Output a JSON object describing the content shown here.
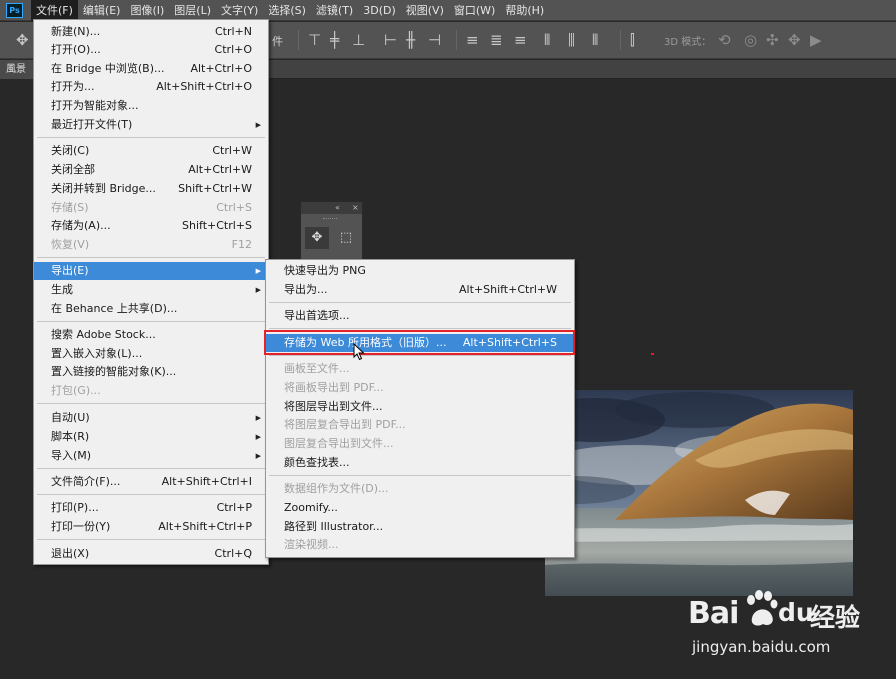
{
  "app": {
    "logo_text": "Ps"
  },
  "menubar": {
    "items": [
      "文件(F)",
      "编辑(E)",
      "图像(I)",
      "图层(L)",
      "文字(Y)",
      "选择(S)",
      "滤镜(T)",
      "3D(D)",
      "视图(V)",
      "窗口(W)",
      "帮助(H)"
    ]
  },
  "optionsbar": {
    "file_label_fragment": "件",
    "mode_3d_label": "3D 模式："
  },
  "document": {
    "tab_label": "風景"
  },
  "file_menu": {
    "items": [
      {
        "label": "新建(N)...",
        "shortcut": "Ctrl+N"
      },
      {
        "label": "打开(O)...",
        "shortcut": "Ctrl+O"
      },
      {
        "label": "在 Bridge 中浏览(B)...",
        "shortcut": "Alt+Ctrl+O"
      },
      {
        "label": "打开为...",
        "shortcut": "Alt+Shift+Ctrl+O"
      },
      {
        "label": "打开为智能对象...",
        "shortcut": ""
      },
      {
        "label": "最近打开文件(T)",
        "shortcut": "",
        "submenu": true
      },
      {
        "label": "关闭(C)",
        "shortcut": "Ctrl+W"
      },
      {
        "label": "关闭全部",
        "shortcut": "Alt+Ctrl+W"
      },
      {
        "label": "关闭并转到 Bridge...",
        "shortcut": "Shift+Ctrl+W"
      },
      {
        "label": "存储(S)",
        "shortcut": "Ctrl+S",
        "disabled": true
      },
      {
        "label": "存储为(A)...",
        "shortcut": "Shift+Ctrl+S"
      },
      {
        "label": "恢复(V)",
        "shortcut": "F12",
        "disabled": true
      },
      {
        "label": "导出(E)",
        "shortcut": "",
        "submenu": true,
        "highlighted": true
      },
      {
        "label": "生成",
        "shortcut": "",
        "submenu": true
      },
      {
        "label": "在 Behance 上共享(D)...",
        "shortcut": ""
      },
      {
        "label": "搜索 Adobe Stock...",
        "shortcut": ""
      },
      {
        "label": "置入嵌入对象(L)...",
        "shortcut": ""
      },
      {
        "label": "置入链接的智能对象(K)...",
        "shortcut": ""
      },
      {
        "label": "打包(G)...",
        "shortcut": "",
        "disabled": true
      },
      {
        "label": "自动(U)",
        "shortcut": "",
        "submenu": true
      },
      {
        "label": "脚本(R)",
        "shortcut": "",
        "submenu": true
      },
      {
        "label": "导入(M)",
        "shortcut": "",
        "submenu": true
      },
      {
        "label": "文件简介(F)...",
        "shortcut": "Alt+Shift+Ctrl+I"
      },
      {
        "label": "打印(P)...",
        "shortcut": "Ctrl+P"
      },
      {
        "label": "打印一份(Y)",
        "shortcut": "Alt+Shift+Ctrl+P"
      },
      {
        "label": "退出(X)",
        "shortcut": "Ctrl+Q"
      }
    ]
  },
  "export_menu": {
    "items": [
      {
        "label": "快速导出为 PNG",
        "shortcut": ""
      },
      {
        "label": "导出为...",
        "shortcut": "Alt+Shift+Ctrl+W"
      },
      {
        "label": "导出首选项...",
        "shortcut": ""
      },
      {
        "label": "存储为 Web 所用格式（旧版）...",
        "shortcut": "Alt+Shift+Ctrl+S",
        "highlighted": true
      },
      {
        "label": "画板至文件...",
        "shortcut": "",
        "disabled": true
      },
      {
        "label": "将画板导出到 PDF...",
        "shortcut": "",
        "disabled": true
      },
      {
        "label": "将图层导出到文件...",
        "shortcut": ""
      },
      {
        "label": "将图层复合导出到 PDF...",
        "shortcut": "",
        "disabled": true
      },
      {
        "label": "图层复合导出到文件...",
        "shortcut": "",
        "disabled": true
      },
      {
        "label": "颜色查找表...",
        "shortcut": ""
      },
      {
        "label": "数据组作为文件(D)...",
        "shortcut": "",
        "disabled": true
      },
      {
        "label": "Zoomify...",
        "shortcut": ""
      },
      {
        "label": "路径到 Illustrator...",
        "shortcut": ""
      },
      {
        "label": "渲染视频...",
        "shortcut": "",
        "disabled": true
      }
    ]
  },
  "watermark": {
    "brand": "Bai",
    "brand_suffix": "du",
    "product": "经验",
    "url": "jingyan.baidu.com"
  },
  "colors": {
    "highlight": "#3c8ad8",
    "annotation_box": "#e3222a",
    "menu_bg": "#f0f0f0",
    "chrome": "#535353"
  }
}
